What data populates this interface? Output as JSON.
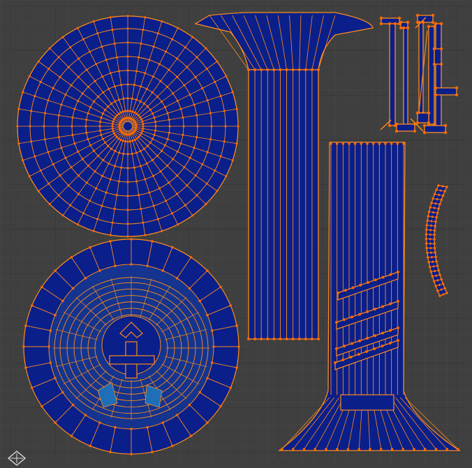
{
  "editor": {
    "name": "UV Editor",
    "background": "#3f3f3f",
    "grid_minor": "#474747",
    "grid_major": "#2f2f2f",
    "uv_face_fill": "#0a1f8a",
    "uv_edge_color": "#ff8c1a",
    "uv_vertex_color": "#ff6a00",
    "selected_face_fill": "#14348f",
    "highlight_face_fill": "#1e6fb8",
    "cursor_icon": "2d-cursor-icon"
  },
  "islands": [
    "top-disc",
    "bottom-disc",
    "top-trumpet-column",
    "small-pieces",
    "lower-column",
    "curved-strip"
  ]
}
